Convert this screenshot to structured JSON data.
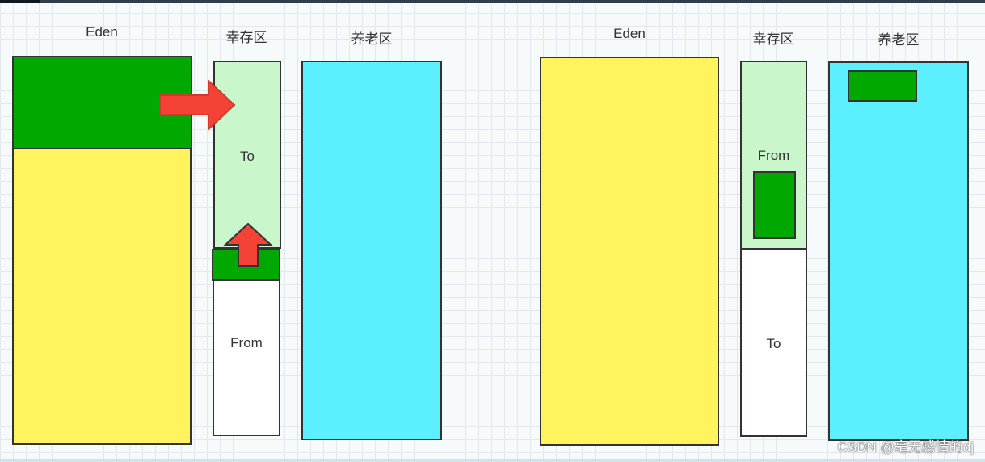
{
  "left": {
    "eden_label": "Eden",
    "survivor_label": "幸存区",
    "old_label": "养老区",
    "to_label": "To",
    "from_label": "From"
  },
  "right": {
    "eden_label": "Eden",
    "survivor_label": "幸存区",
    "old_label": "养老区",
    "from_label": "From",
    "to_label": "To"
  },
  "watermark": "CSDN @毫无感情的dj",
  "colors": {
    "eden": "#fff45e",
    "live_objects": "#00a800",
    "survivor_active": "#c9f7cb",
    "survivor_empty": "#ffffff",
    "old": "#5cf0ff",
    "arrow": "#f44336"
  },
  "icons": {
    "move_arrow": "right-arrow-icon",
    "promote_arrow": "up-arrow-icon"
  }
}
